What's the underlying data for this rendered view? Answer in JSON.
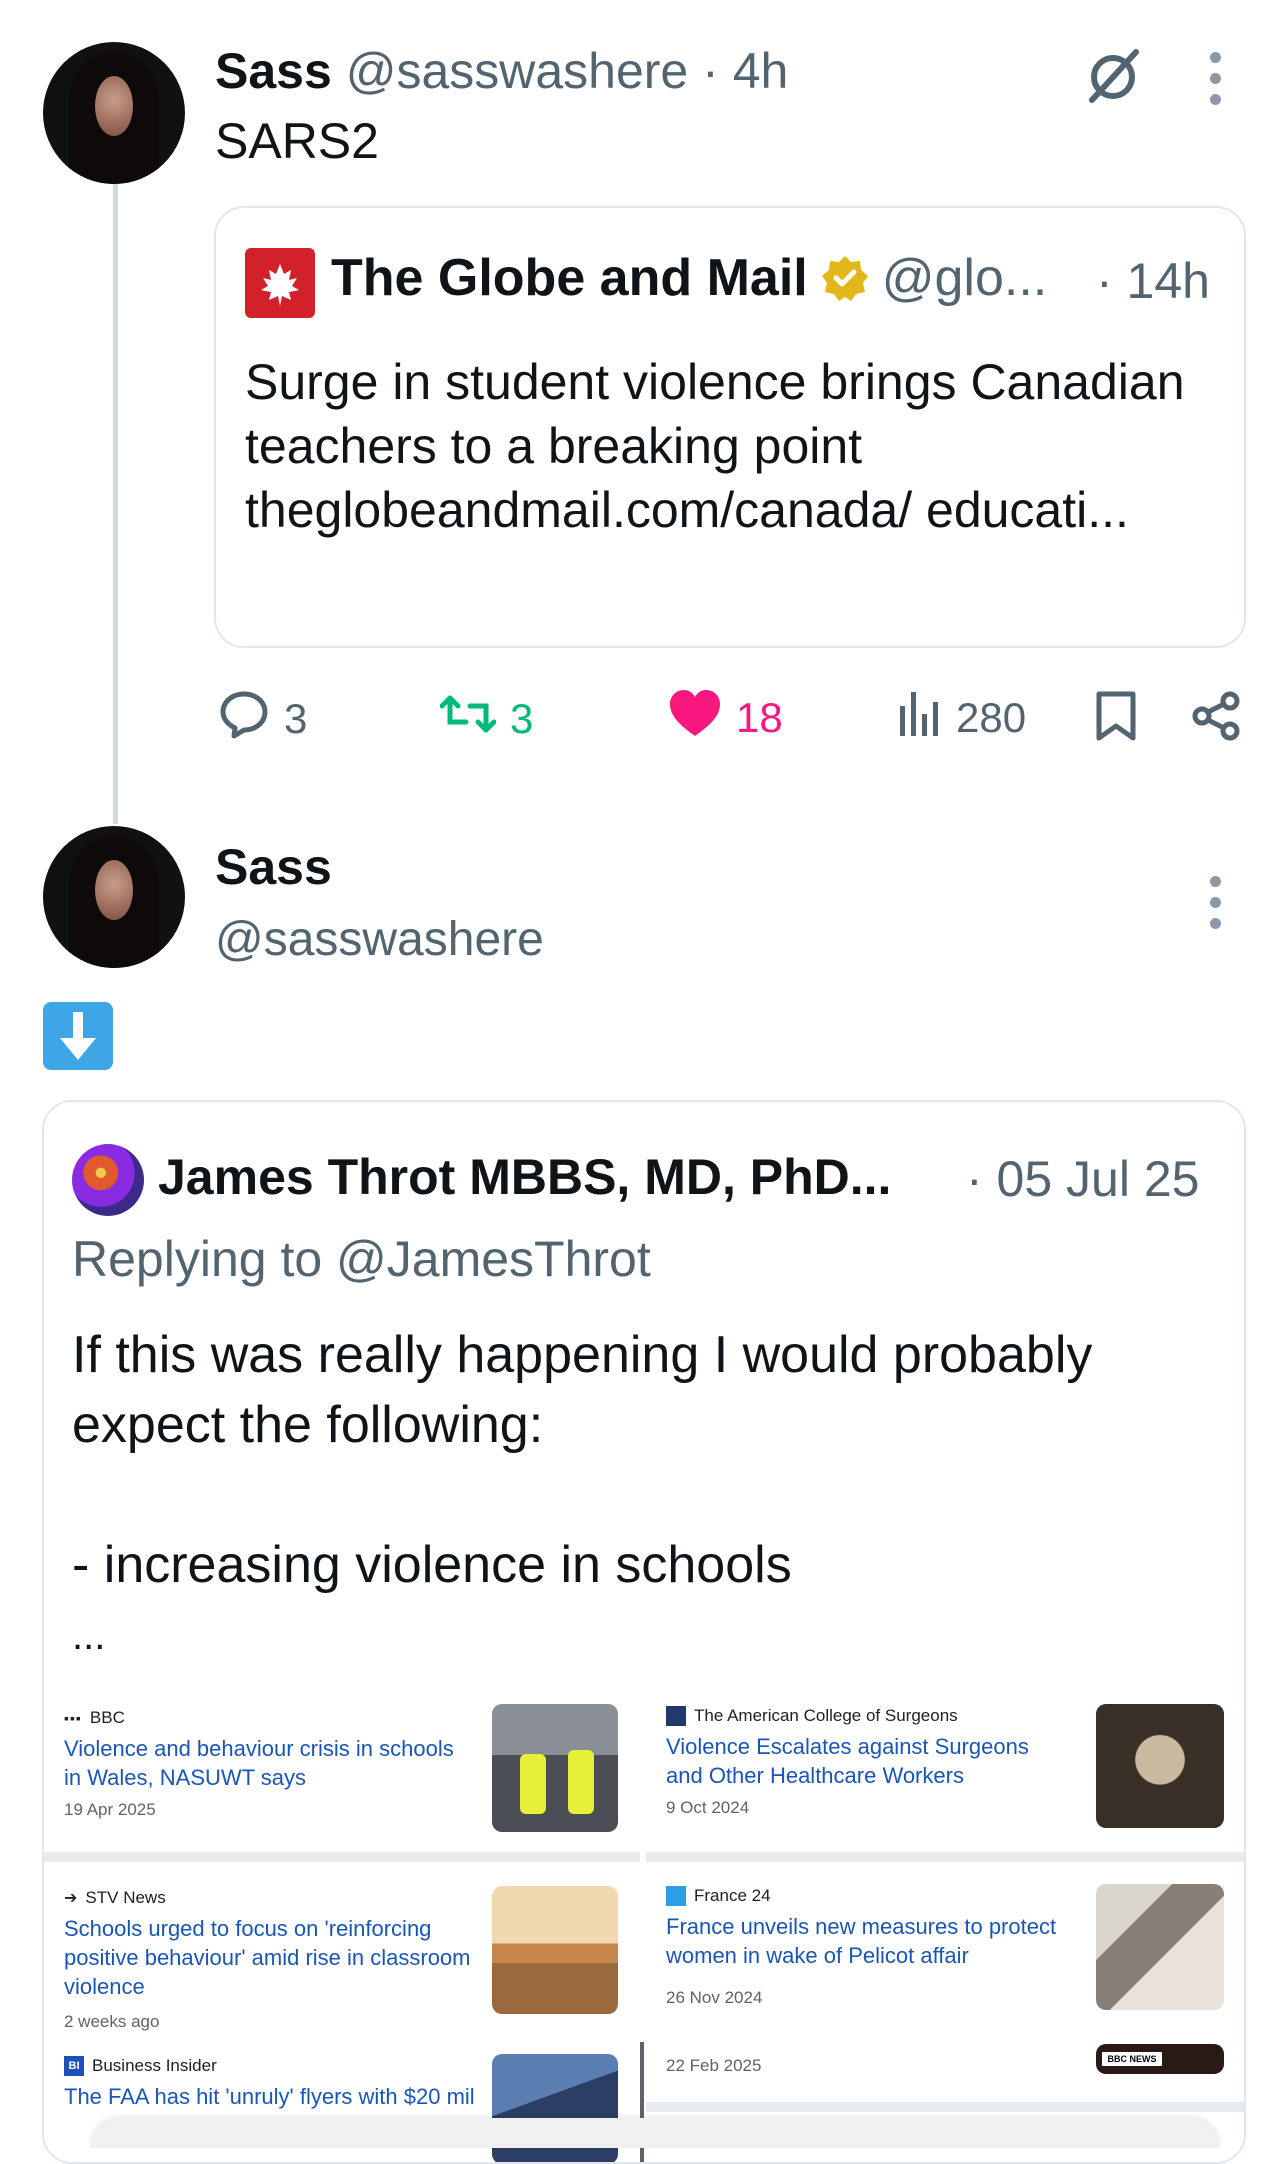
{
  "post1": {
    "author_name": "Sass",
    "author_handle": "@sasswashere",
    "separator": "·",
    "time": "4h",
    "text": "SARS2"
  },
  "quote": {
    "source_name": "The Globe and Mail",
    "source_handle": "@glo...",
    "time": "· 14h",
    "text": "Surge in student violence brings Canadian teachers to a breaking point theglobeandmail.com/canada/ educati..."
  },
  "actions": {
    "replies": "3",
    "reposts": "3",
    "likes": "18",
    "views": "280"
  },
  "post2": {
    "author_name": "Sass",
    "author_handle": "@sasswashere",
    "emoji": "⬇️"
  },
  "embedded": {
    "author_name": "James Throt MBBS, MD, PhD...",
    "time": "· 05 Jul 25",
    "replying_to": "Replying to @JamesThrot",
    "text_line1": "If this was really happening I would probably",
    "text_line2": "expect the following:",
    "text_line3": "- increasing violence in schools",
    "ellipsis": "..."
  },
  "news": [
    {
      "source": "BBC",
      "title": "Violence and behaviour crisis in schools in Wales, NASUWT says",
      "date": "19 Apr 2025"
    },
    {
      "source": "The American College of Surgeons",
      "title": "Violence Escalates against Surgeons and Other Healthcare Workers",
      "date": "9 Oct 2024"
    },
    {
      "source": "STV News",
      "title": "Schools urged to focus on 'reinforcing positive behaviour' amid rise in classroom violence",
      "date": "2 weeks ago"
    },
    {
      "source": "France 24",
      "title": "France unveils new measures to protect women in wake of Pelicot affair",
      "date": "26 Nov 2024"
    },
    {
      "source": "Business Insider",
      "title": "The FAA has hit 'unruly' flyers with $20 mil",
      "date": ""
    },
    {
      "source": "",
      "title": "",
      "date": "22 Feb 2025"
    }
  ],
  "colors": {
    "like": "#f91880",
    "repost": "#00ba7c",
    "verified": "#e2b719",
    "globe_red": "#d3212b",
    "link_blue": "#1a56b5"
  },
  "icons": [
    "grok-icon",
    "more-icon",
    "reply-icon",
    "repost-icon",
    "heart-icon",
    "views-icon",
    "bookmark-icon",
    "share-icon",
    "down-arrow-emoji"
  ]
}
